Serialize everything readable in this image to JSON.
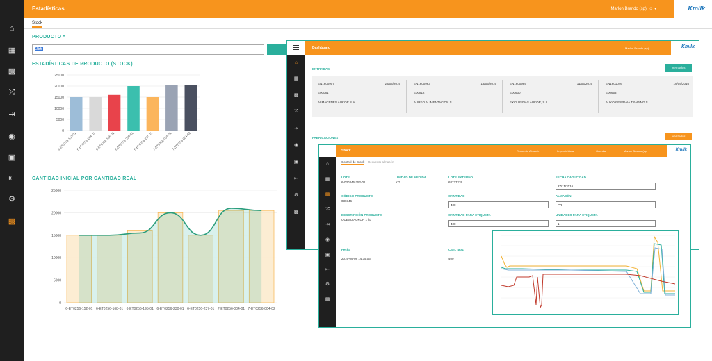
{
  "header": {
    "title": "Estadísticas",
    "user": "Marlon Brando (sp)",
    "logo": "Kmilk"
  },
  "tabs": {
    "active": "Stock"
  },
  "product": {
    "label": "PRODUCTO *",
    "value": "256"
  },
  "chart1": {
    "title": "ESTADÍSTICAS DE PRODUCTO (STOCK)",
    "chart_data": {
      "type": "bar",
      "categories": [
        "6-ET0256-152-01",
        "6-ET0256-168-01",
        "6-ET0256-195-01",
        "6-ET0256-230-01",
        "6-ET0256-237-01",
        "7-ET0256-004-01",
        "7-ET0256-004-02"
      ],
      "values": [
        15000,
        15000,
        16000,
        20000,
        15000,
        20500,
        20500
      ],
      "colors": [
        "#9dbdd8",
        "#d9d9d9",
        "#e8434b",
        "#3bbfae",
        "#fbb55c",
        "#9aa3b4",
        "#4a5060"
      ],
      "yticks": [
        "0",
        "5000",
        "10000",
        "15000",
        "20000",
        "25000"
      ],
      "ylim": [
        0,
        25000
      ]
    }
  },
  "chart2": {
    "title": "CANTIDAD INICIAL POR CANTIDAD REAL",
    "chart_data": {
      "type": "bar",
      "categories": [
        "6-ET0256-152-01",
        "6-ET0256-168-01",
        "6-ET0256-195-01",
        "6-ET0256-230-01",
        "6-ET0256-237-01",
        "7-ET0256-004-01",
        "7-ET0256-004-02"
      ],
      "values": [
        15000,
        15000,
        16000,
        20000,
        15000,
        20500,
        20500
      ],
      "line": [
        15000,
        15000,
        15500,
        20000,
        15000,
        21000,
        20500
      ],
      "yticks": [
        "0",
        "5000",
        "10000",
        "15000",
        "20000",
        "25000"
      ],
      "ylim": [
        0,
        25000
      ]
    }
  },
  "dashboard": {
    "title": "Dashboard",
    "user": "Marlon Brando (sp)",
    "entradas_title": "ENTRADAS",
    "ver_todos": "Ver todos",
    "entries": [
      {
        "code": "EN1600907",
        "date": "28/04/2016",
        "ref": "E00081",
        "name": "ALMACENES AUKOR S.A."
      },
      {
        "code": "EN1600963",
        "date": "13/05/2016",
        "ref": "E00812",
        "name": "AURKO ALIMENTACIÓN S.L."
      },
      {
        "code": "EN1600989",
        "date": "11/05/2016",
        "ref": "E00630",
        "name": "EXCLUSIVAS AUKOR, S.L."
      },
      {
        "code": "EN1601046",
        "date": "19/05/2016",
        "ref": "E00653",
        "name": "AUKOR ESPAÑA TRADING S.L."
      }
    ],
    "fabricaciones_title": "FABRICACIONES"
  },
  "stock": {
    "title": "Stock",
    "actions": [
      "Recuento Almacén",
      "Imprimir Lista",
      "Guardar"
    ],
    "user": "Marlon Brando (sp)",
    "tabs": [
      "Control de Stock",
      "Recuento almacén"
    ],
    "lote_label": "LOTE",
    "lote_value": "6-030346-252-01",
    "unidad_label": "UNIDAD DE MEDIDA",
    "unidad_value": "KG",
    "lote_ext_label": "LOTE EXTERNO",
    "lote_ext_value": "68727239",
    "fecha_cad_label": "FECHA CADUCIDAD",
    "fecha_cad_value": "27/11/2016",
    "codigo_label": "CÓDIGO PRODUCTO",
    "codigo_value": "030346",
    "cantidad_label": "CANTIDAD",
    "cantidad_value": "400",
    "almacen_label": "ALMACÉN",
    "almacen_value": "PR",
    "desc_label": "DESCRIPCIÓN PRODUCTO",
    "desc_value": "QUESO AUKOR 1 kg",
    "cant_etiq_label": "CANTIDAD PARA ETIQUETA",
    "cant_etiq_value": "400",
    "unid_etiq_label": "UNIDADES PARA ETIQUETA",
    "unid_etiq_value": "1",
    "fecha_label": "Fecha",
    "fecha_value": "2016-09-08 14:35:06",
    "cant_mov_label": "Cant. Mov.",
    "cant_mov_value": "400"
  }
}
